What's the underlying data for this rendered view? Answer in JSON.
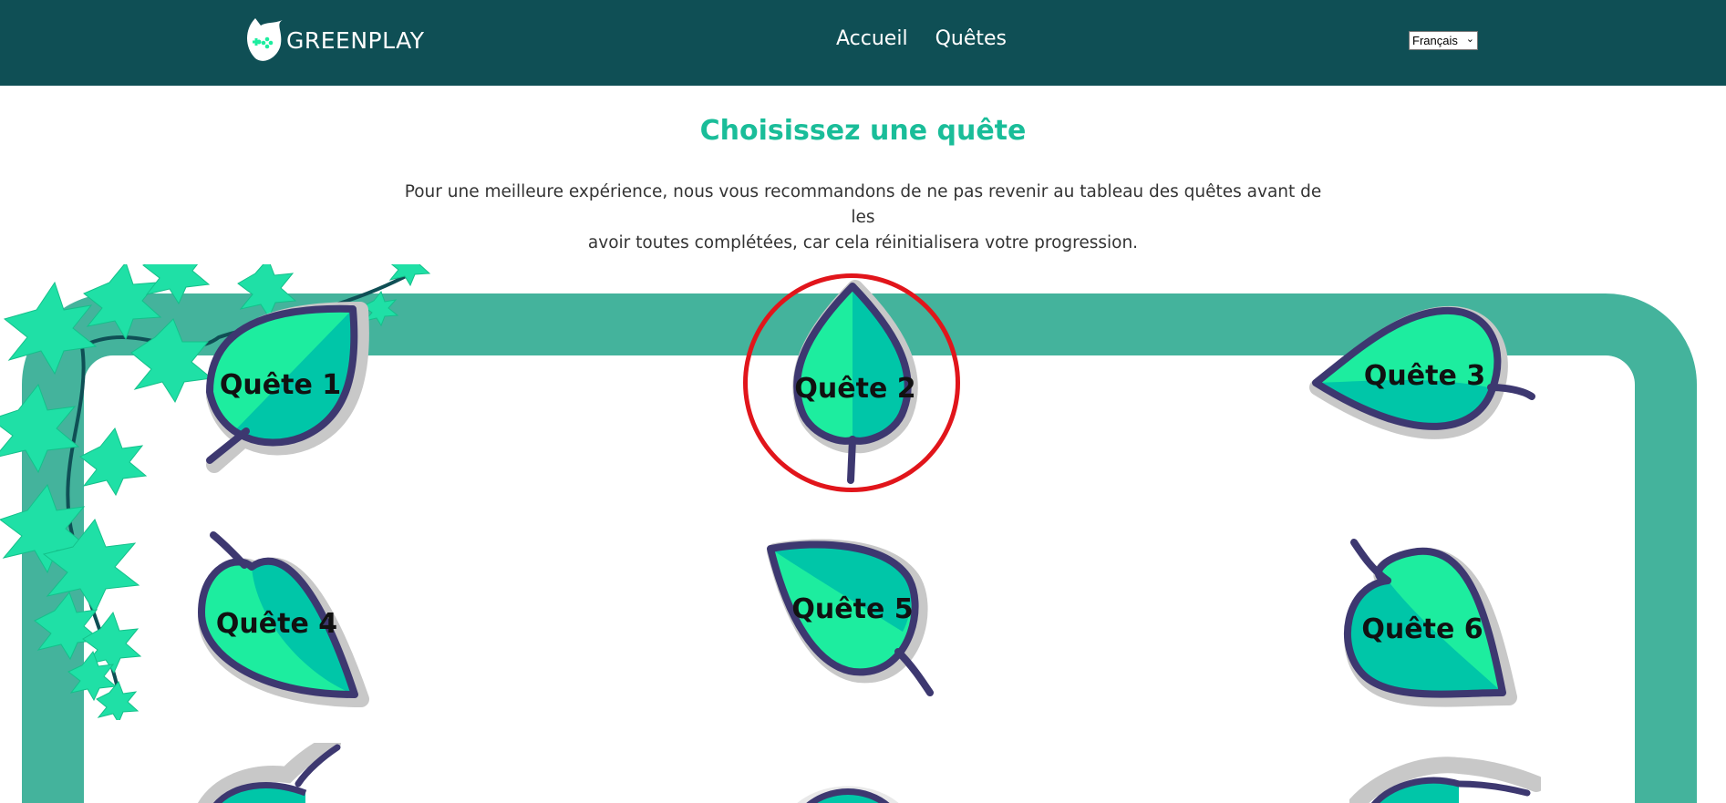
{
  "header": {
    "logo_text": "GREENPLAY",
    "nav": [
      {
        "label": "Accueil"
      },
      {
        "label": "Quêtes"
      }
    ],
    "language": {
      "selected": "Français"
    }
  },
  "main": {
    "title": "Choisissez une quête",
    "intro_line1": "Pour une meilleure expérience, nous vous recommandons de ne pas revenir au tableau des quêtes avant de les",
    "intro_line2": "avoir toutes complétées, car cela réinitialisera votre progression.",
    "quests": [
      {
        "label": "Quête 1"
      },
      {
        "label": "Quête 2"
      },
      {
        "label": "Quête 3"
      },
      {
        "label": "Quête 4"
      },
      {
        "label": "Quête 5"
      },
      {
        "label": "Quête 6"
      }
    ]
  },
  "colors": {
    "header_bg": "#0f4f55",
    "title": "#1abd99",
    "board": "#44b39c",
    "leaf_light": "#1ded9f",
    "leaf_dark": "#00c6a8",
    "leaf_outline": "#3d3870",
    "highlight": "#e1151b"
  }
}
